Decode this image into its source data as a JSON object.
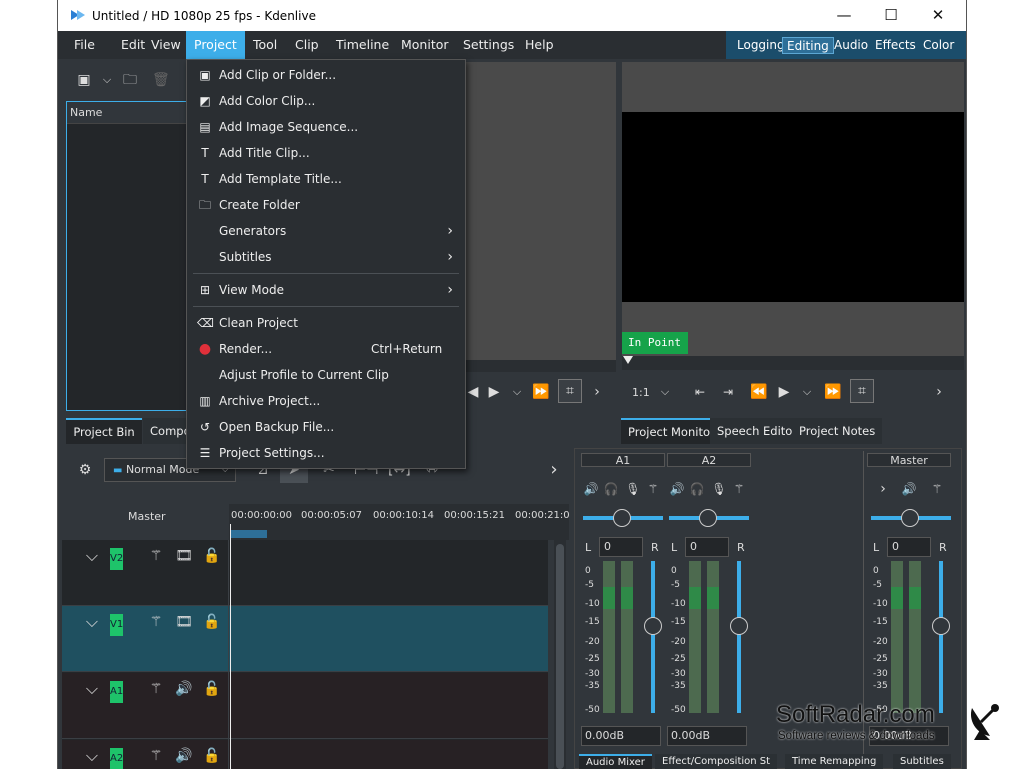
{
  "window": {
    "title": "Untitled / HD 1080p 25 fps - Kdenlive"
  },
  "window_controls": {
    "minimize": "—",
    "maximize": "☐",
    "close": "✕"
  },
  "menu": [
    "File",
    "Edit",
    "View",
    "Project",
    "Tool",
    "Clip",
    "Timeline",
    "Monitor",
    "Settings",
    "Help"
  ],
  "layouts": [
    "Logging",
    "Editing",
    "Audio",
    "Effects",
    "Color"
  ],
  "project_menu": {
    "items": [
      {
        "label": "Add Clip or Folder...",
        "icon": "add-clip-icon"
      },
      {
        "label": "Add Color Clip...",
        "icon": "color-clip-icon"
      },
      {
        "label": "Add Image Sequence...",
        "icon": "image-sequence-icon"
      },
      {
        "label": "Add Title Clip...",
        "icon": "title-clip-icon"
      },
      {
        "label": "Add Template Title...",
        "icon": "template-title-icon"
      },
      {
        "label": "Create Folder",
        "icon": "folder-icon"
      },
      {
        "label": "Generators",
        "icon": ""
      },
      {
        "label": "Subtitles",
        "icon": ""
      },
      {
        "label": "View Mode",
        "icon": "view-mode-icon"
      },
      {
        "label": "Clean Project",
        "icon": "clean-icon"
      },
      {
        "label": "Render...",
        "icon": "render-icon",
        "shortcut": "Ctrl+Return"
      },
      {
        "label": "Adjust Profile to Current Clip",
        "icon": ""
      },
      {
        "label": "Archive Project...",
        "icon": "archive-icon"
      },
      {
        "label": "Open Backup File...",
        "icon": "backup-icon"
      },
      {
        "label": "Project Settings...",
        "icon": "settings-icon"
      }
    ]
  },
  "bin": {
    "column_name": "Name",
    "tabs": [
      "Project Bin",
      "Compos"
    ]
  },
  "monitor": {
    "in_point": "In Point",
    "zoom": "1:1",
    "tabs": [
      "Project Monitor",
      "Speech Editor",
      "Project Notes"
    ]
  },
  "timeline": {
    "mode": "Normal Mode",
    "master_label": "Master",
    "ruler": [
      "00:00:00:00",
      "00:00:05:07",
      "00:00:10:14",
      "00:00:15:21",
      "00:00:21:0"
    ],
    "tracks": [
      "V2",
      "V1",
      "A1",
      "A2"
    ]
  },
  "mixer": {
    "channels": [
      {
        "name": "A1",
        "gain": "0",
        "db": "0.00dB"
      },
      {
        "name": "A2",
        "gain": "0",
        "db": "0.00dB"
      },
      {
        "name": "Master",
        "gain": "0",
        "db": "0.00dB"
      }
    ],
    "left_label": "L",
    "right_label": "R",
    "scale": [
      "0",
      "-5",
      "-10",
      "-15",
      "-20",
      "-25",
      "-30",
      "-35",
      "-50"
    ],
    "bottom_tabs": [
      "Audio Mixer",
      "Effect/Composition St",
      "Time Remapping",
      "Subtitles"
    ]
  },
  "watermark": {
    "brand": "SoftRadar.com",
    "tagline": "Software reviews & downloads"
  }
}
